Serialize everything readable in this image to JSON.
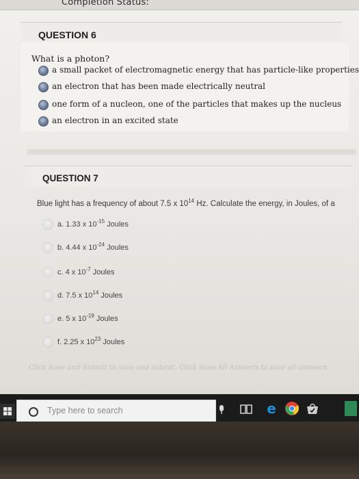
{
  "header": {
    "status_label": "Completion Status:"
  },
  "question6": {
    "title": "QUESTION 6",
    "text": "What is a photon?",
    "options": [
      "a small packet of electromagnetic energy that has particle-like properties",
      "an electron that has been made electrically neutral",
      "one form of a nucleon, one of the particles that makes up the nucleus",
      "an electron in an excited state"
    ]
  },
  "question7": {
    "title": "QUESTION 7",
    "text_prefix": "Blue light has a frequency of about 7.5 x 10",
    "text_exp": "14",
    "text_suffix": " Hz. Calculate the energy, in Joules, of a",
    "options": [
      {
        "prefix": "a. 1.33 x 10",
        "exp": "-15",
        "suffix": " Joules"
      },
      {
        "prefix": "b. 4.44 x 10",
        "exp": "-24",
        "suffix": " Joules"
      },
      {
        "prefix": "c. 4 x 10",
        "exp": "-7",
        "suffix": " Joules"
      },
      {
        "prefix": "d. 7.5 x 10",
        "exp": "14",
        "suffix": " Joules"
      },
      {
        "prefix": "e. 5 x 10",
        "exp": "-19",
        "suffix": " Joules"
      },
      {
        "prefix": "f. 2.25 x 10",
        "exp": "23",
        "suffix": " Joules"
      }
    ]
  },
  "footer": {
    "note": "Click Save and Submit to save and submit. Click Save All Answers to save all answers."
  },
  "taskbar": {
    "search_placeholder": "Type here to search",
    "colors": {
      "edge_blue": "#1e90d6",
      "chrome_red": "#e44134",
      "chrome_green": "#3aa757",
      "chrome_yellow": "#f7c52b"
    }
  }
}
